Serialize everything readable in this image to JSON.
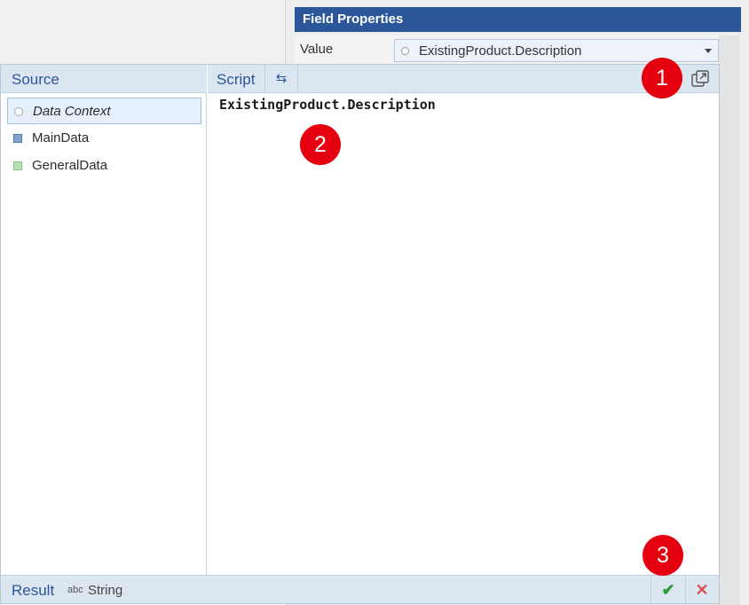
{
  "field_properties": {
    "title": "Field Properties",
    "value_label": "Value",
    "value_selected": "ExistingProduct.Description"
  },
  "source": {
    "title": "Source",
    "items": [
      {
        "label": "Data Context",
        "icon": "circle-icon",
        "selected": true
      },
      {
        "label": "MainData",
        "icon": "blue-square-icon",
        "color": "#7fa2d0"
      },
      {
        "label": "GeneralData",
        "icon": "green-square-icon",
        "color": "#b8e2b5"
      }
    ]
  },
  "script": {
    "title": "Script",
    "code": "ExistingProduct.Description"
  },
  "result": {
    "label": "Result",
    "type_icon": "abc",
    "type": "String"
  },
  "callouts": [
    "1",
    "2",
    "3"
  ],
  "colors": {
    "header_blue": "#2b579a",
    "panel_header": "#dce6f1",
    "callout_red": "#e4000f",
    "ok_green": "#2f9a3a",
    "cancel_red": "#d9534f"
  }
}
